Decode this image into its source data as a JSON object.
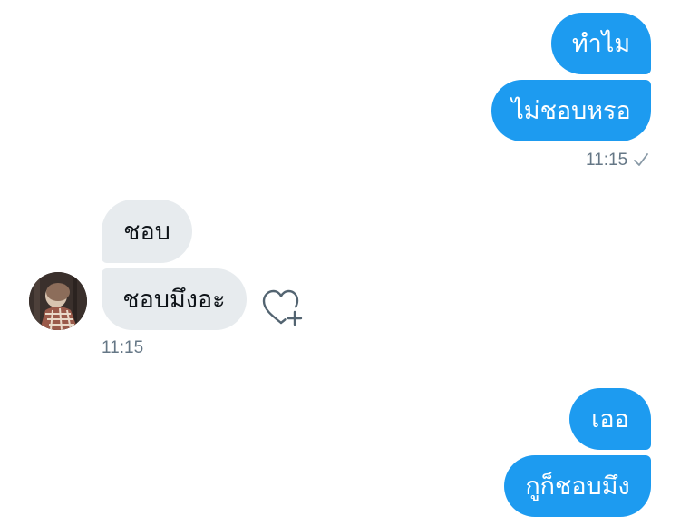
{
  "messages": {
    "sent_1": "ทำไม",
    "sent_2": "ไม่ชอบหรอ",
    "sent_time": "11:15",
    "received_1": "ชอบ",
    "received_2": "ชอบมึงอะ",
    "received_time": "11:15",
    "sent_3": "เออ",
    "sent_4": "กูก็ชอบมึง"
  },
  "icons": {
    "read_receipt": "check-icon",
    "react": "heart-plus-icon",
    "avatar": "user-avatar"
  },
  "colors": {
    "sent_bubble": "#1d9bf0",
    "received_bubble": "#e7ebee",
    "timestamp": "#657786"
  }
}
